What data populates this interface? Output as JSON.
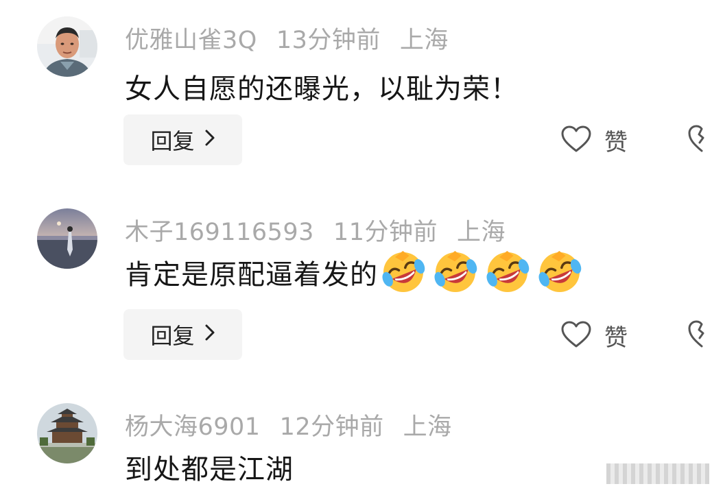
{
  "comments": [
    {
      "username": "优雅山雀3Q",
      "time": "13分钟前",
      "location": "上海",
      "text": "女人自愿的还曝光，以耻为荣！",
      "reply_label": "回复",
      "like_label": "赞"
    },
    {
      "username": "木子169116593",
      "time": "11分钟前",
      "location": "上海",
      "text": "肯定是原配逼着发的",
      "emojis": [
        "rofl-laughing-emoji",
        "rofl-laughing-emoji",
        "rofl-laughing-emoji",
        "rofl-laughing-emoji"
      ],
      "reply_label": "回复",
      "like_label": "赞"
    },
    {
      "username": "杨大海6901",
      "time": "12分钟前",
      "location": "上海",
      "text": "到处都是江湖"
    }
  ],
  "icons": {
    "reply_chevron": "chevron-right-icon",
    "like": "heart-outline-icon",
    "dislike": "broken-heart-icon"
  },
  "colors": {
    "meta_text": "#a9a9a9",
    "body_text": "#161616",
    "reply_bg": "#f4f4f4"
  }
}
